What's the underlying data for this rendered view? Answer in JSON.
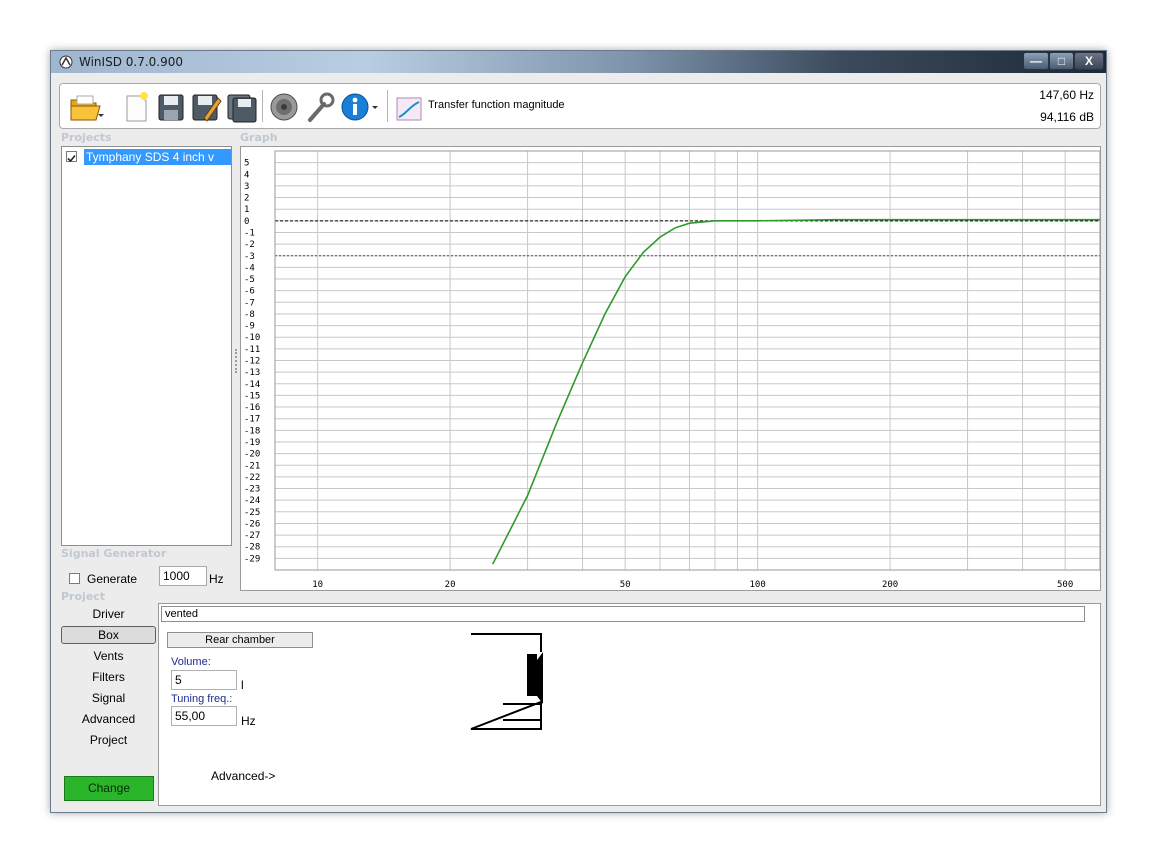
{
  "window": {
    "title": "WinISD 0.7.0.900"
  },
  "toolbar": {
    "icons": [
      "open-folder-icon",
      "new-document-icon",
      "save-icon",
      "save-as-icon",
      "save-all-icon",
      "driver-icon",
      "tools-icon",
      "info-icon"
    ],
    "graph_selector_label": "Transfer function magnitude",
    "readout_frequency": "147,60 Hz",
    "readout_level": "94,116 dB"
  },
  "sections": {
    "projects": "Projects",
    "graph": "Graph",
    "signal_generator": "Signal Generator",
    "project": "Project"
  },
  "projects": [
    {
      "name": "Tymphany SDS 4 inch v",
      "checked": true
    }
  ],
  "signal_generator": {
    "generate_label": "Generate",
    "generate_checked": false,
    "frequency_value": "1000",
    "frequency_unit": "Hz"
  },
  "project_nav": {
    "items": [
      "Driver",
      "Box",
      "Vents",
      "Filters",
      "Signal",
      "Advanced",
      "Project"
    ],
    "active": "Box",
    "change_label": "Change"
  },
  "box": {
    "type_value": "vented",
    "rear_chamber_label": "Rear chamber",
    "volume_label": "Volume:",
    "volume_value": "5",
    "volume_unit": "l",
    "tuning_label": "Tuning freq.:",
    "tuning_value": "55,00",
    "tuning_unit": "Hz",
    "advanced_link": "Advanced->"
  },
  "chart_data": {
    "type": "line",
    "x_scale": "log",
    "xlim": [
      8,
      600
    ],
    "ylim": [
      -30,
      6
    ],
    "x_tick_labels": [
      "10",
      "20",
      "50",
      "100",
      "200",
      "500"
    ],
    "y_tick_labels": [
      "5",
      "4",
      "3",
      "2",
      "1",
      "0",
      "-1",
      "-2",
      "-3",
      "-4",
      "-5",
      "-6",
      "-7",
      "-8",
      "-9",
      "-10",
      "-11",
      "-12",
      "-13",
      "-14",
      "-15",
      "-16",
      "-17",
      "-18",
      "-19",
      "-20",
      "-21",
      "-22",
      "-23",
      "-24",
      "-25",
      "-26",
      "-27",
      "-28",
      "-29"
    ],
    "reference_lines": [
      0,
      -3
    ],
    "grid": true,
    "series": [
      {
        "color": "#2e9a2e",
        "x": [
          25,
          30,
          35,
          40,
          45,
          50,
          55,
          60,
          65,
          70,
          80,
          100,
          150,
          200,
          300,
          500,
          600
        ],
        "y": [
          -29.5,
          -23.6,
          -17.3,
          -12.2,
          -8.0,
          -4.8,
          -2.7,
          -1.4,
          -0.6,
          -0.2,
          0.0,
          0.0,
          0.1,
          0.1,
          0.1,
          0.1,
          0.1
        ]
      }
    ]
  }
}
